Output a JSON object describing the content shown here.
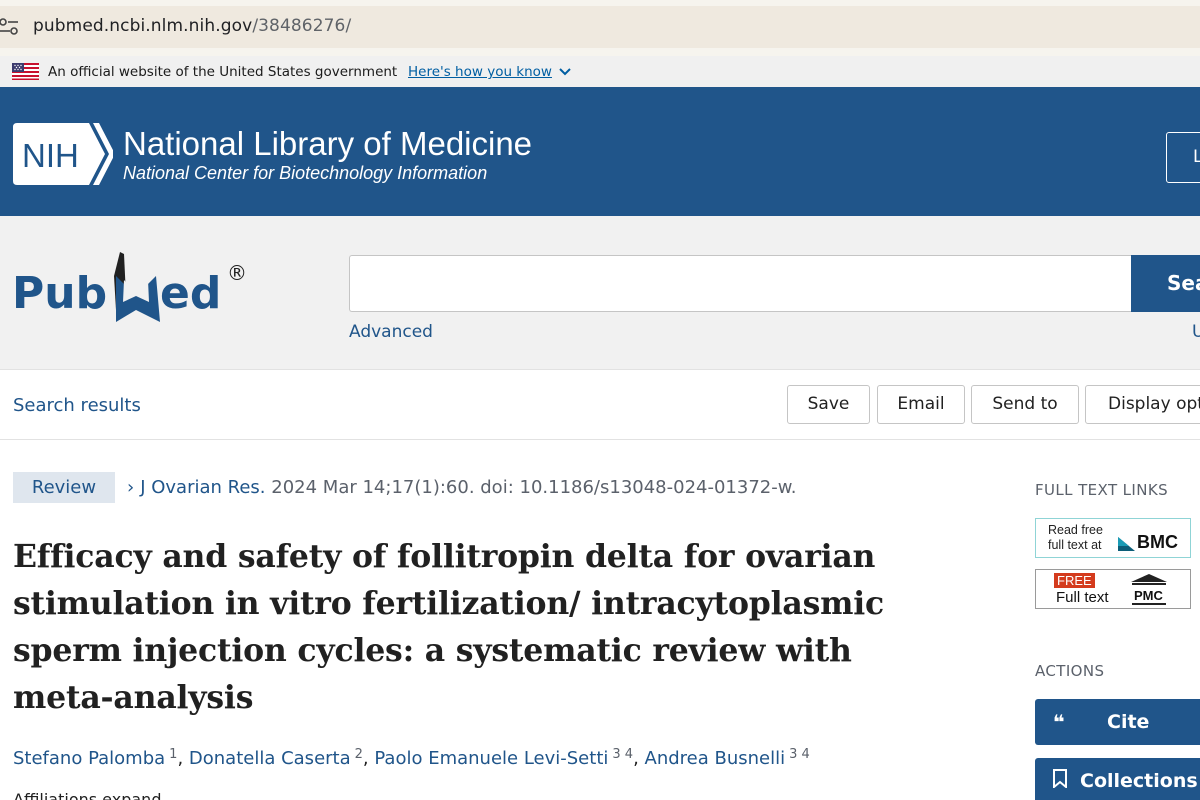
{
  "browser": {
    "url_host": "pubmed.ncbi.nlm.nih.gov",
    "url_path": "/38486276/"
  },
  "gov_banner": {
    "text": "An official website of the United States government",
    "link": "Here's how you know"
  },
  "nlm_header": {
    "logo_text": "NIH",
    "title": "National Library of Medicine",
    "subtitle": "National Center for Biotechnology Information",
    "login_label": "L"
  },
  "search": {
    "logo_left": "Pub",
    "logo_right": "ed",
    "registered": "®",
    "input_value": "",
    "button_label": "Sea",
    "advanced_label": "Advanced",
    "user_guide_label": "U"
  },
  "toolbar": {
    "back_label": "Search results",
    "save_label": "Save",
    "email_label": "Email",
    "send_label": "Send to",
    "display_label": "Display opti"
  },
  "article": {
    "type": "Review",
    "chevron": "›",
    "journal": "J Ovarian Res.",
    "citation_rest": "2024 Mar 14;17(1):60. doi: 10.1186/s13048-024-01372-w.",
    "title": "Efficacy and safety of follitropin delta for ovarian stimulation in vitro fertilization/ intracytoplasmic sperm injection cycles: a systematic review with meta-analysis",
    "authors": [
      {
        "name": "Stefano Palomba",
        "affils": "1"
      },
      {
        "name": "Donatella Caserta",
        "affils": "2"
      },
      {
        "name": "Paolo Emanuele Levi-Setti",
        "affils": "3  4"
      },
      {
        "name": "Andrea Busnelli",
        "affils": "3  4"
      }
    ],
    "affiliations_label": "Affiliations  expand"
  },
  "sidebar": {
    "full_text_heading": "FULL TEXT LINKS",
    "bmc": {
      "line1": "Read free",
      "line2": "full text at",
      "brand": "BMC"
    },
    "pmc": {
      "free": "FREE",
      "full": "Full text",
      "brand": "PMC"
    },
    "actions_heading": "ACTIONS",
    "cite_icon": "❝",
    "cite_label": "Cite",
    "collections_label": "Collections"
  },
  "colors": {
    "nlm_blue": "#20558a",
    "badge_bg": "#dfe6ee",
    "pmc_red": "#d43b1d",
    "bmc_border": "#8fd4d6"
  }
}
